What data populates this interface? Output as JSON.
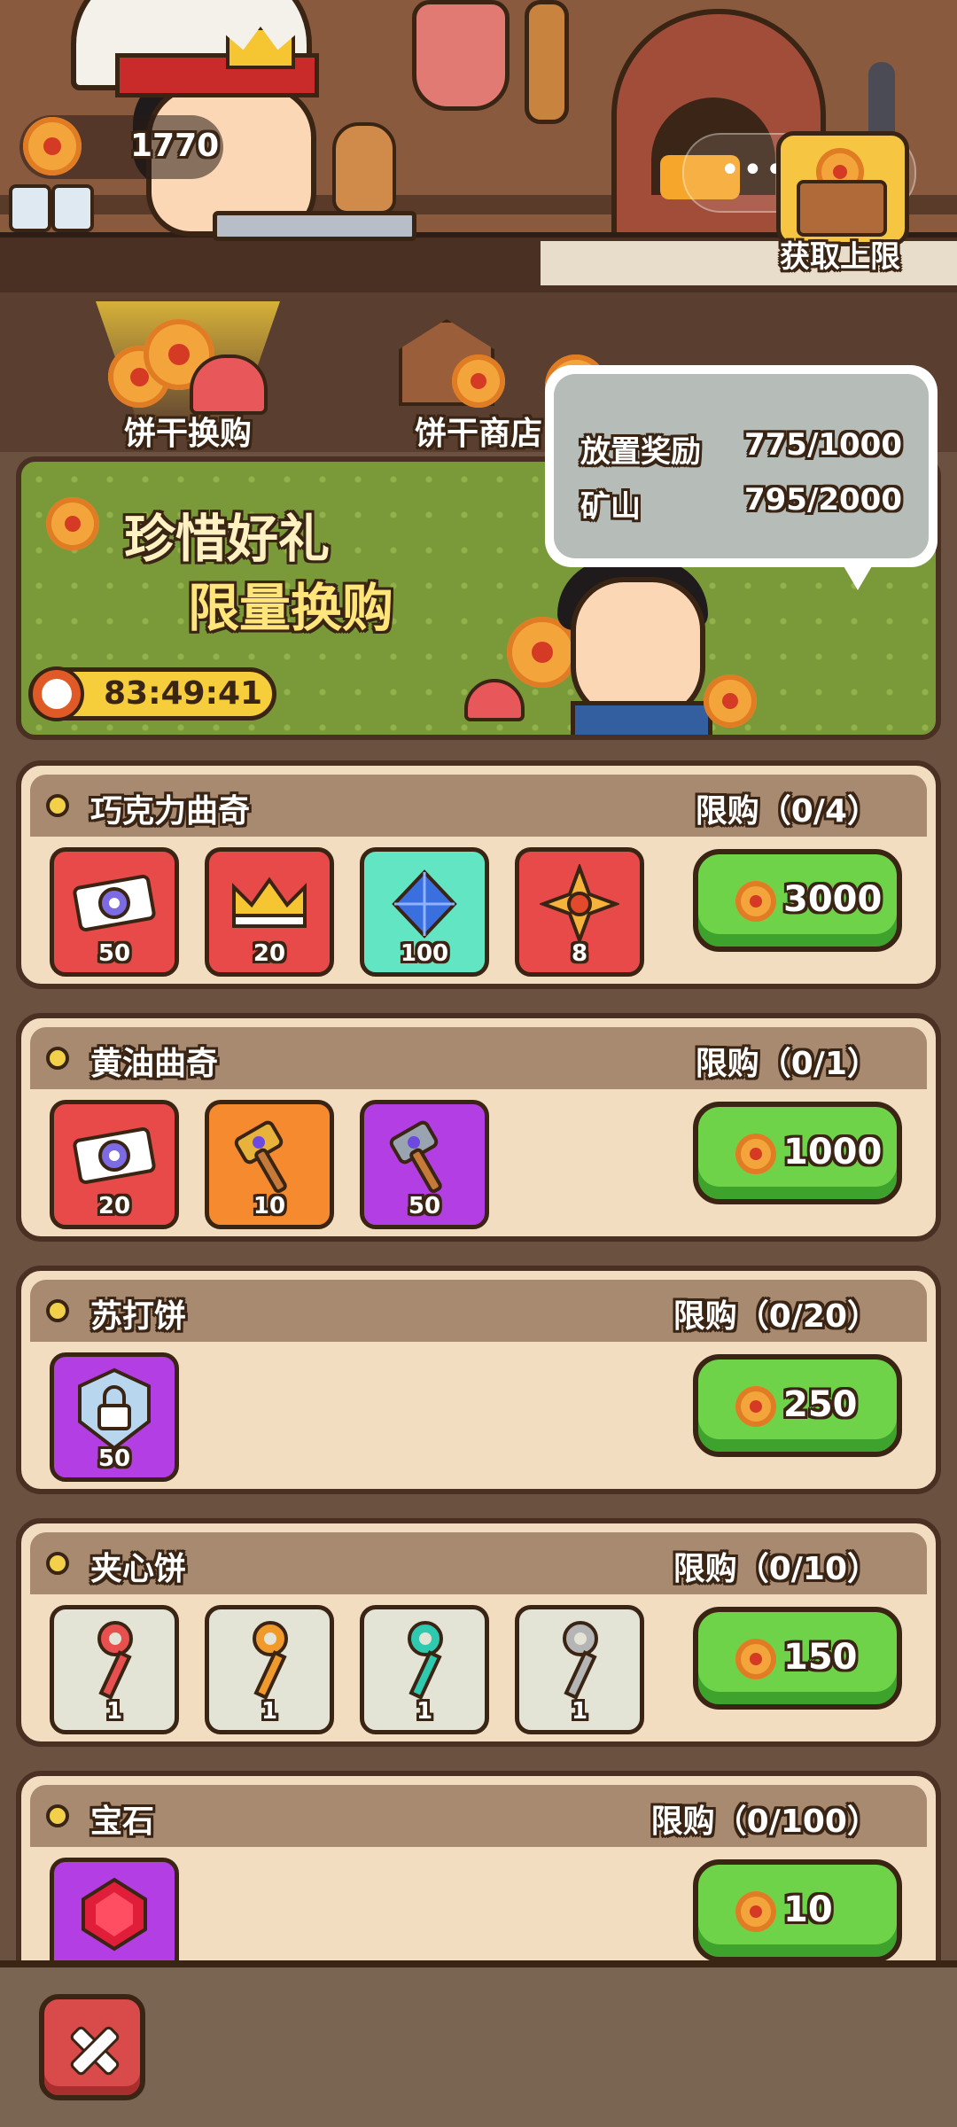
{
  "currency": {
    "icon": "cookie-icon",
    "value": "1770"
  },
  "capsule": {
    "more_icon": "more-icon",
    "more": "•••",
    "target_icon": "target-icon"
  },
  "tabs": [
    {
      "label": "饼干换购",
      "icon": "cookie-exchange-icon",
      "active": true
    },
    {
      "label": "饼干商店",
      "icon": "cookie-shop-icon",
      "active": false
    }
  ],
  "banner": {
    "title_line1": "珍惜好礼",
    "title_line2": "限量换购",
    "timer": "83:49:41",
    "chest_label": "获取上限"
  },
  "tooltip": {
    "rows": [
      {
        "label": "放置奖励",
        "value": "775/1000"
      },
      {
        "label": "矿山",
        "value": "795/2000"
      }
    ]
  },
  "packs": [
    {
      "name": "巧克力曲奇",
      "limit": "限购（0/4）",
      "price": "3000",
      "items": [
        {
          "icon": "ticket-icon",
          "count": "50",
          "bg": "#e84a4a"
        },
        {
          "icon": "crown-icon",
          "count": "20",
          "bg": "#e84a4a"
        },
        {
          "icon": "diamond-icon",
          "count": "100",
          "bg": "#62e5c3"
        },
        {
          "icon": "star-badge-icon",
          "count": "8",
          "bg": "#e84a4a"
        }
      ]
    },
    {
      "name": "黄油曲奇",
      "limit": "限购（0/1）",
      "price": "1000",
      "items": [
        {
          "icon": "ticket-icon",
          "count": "20",
          "bg": "#e84a4a"
        },
        {
          "icon": "hammer-icon",
          "count": "10",
          "bg": "#f68a2e"
        },
        {
          "icon": "hammer-icon",
          "count": "50",
          "bg": "#b33ee3"
        }
      ]
    },
    {
      "name": "苏打饼",
      "limit": "限购（0/20）",
      "price": "250",
      "items": [
        {
          "icon": "lock-shield-icon",
          "count": "50",
          "bg": "#b33ee3"
        }
      ]
    },
    {
      "name": "夹心饼",
      "limit": "限购（0/10）",
      "price": "150",
      "items": [
        {
          "icon": "key-icon",
          "count": "1",
          "bg": "#e3e3d6"
        },
        {
          "icon": "key-icon",
          "count": "1",
          "bg": "#e3e3d6"
        },
        {
          "icon": "key-icon",
          "count": "1",
          "bg": "#e3e3d6"
        },
        {
          "icon": "key-icon",
          "count": "1",
          "bg": "#e3e3d6"
        }
      ]
    },
    {
      "name": "宝石",
      "limit": "限购（0/100）",
      "price": "10",
      "items": [
        {
          "icon": "ruby-icon",
          "count": "",
          "bg": "#b33ee3"
        }
      ]
    }
  ],
  "close_icon": "close-icon",
  "colors": {
    "button_green": "#6ed348",
    "banner_green": "#7a9a3a",
    "panel_beige": "#f3ddc0",
    "header_brown": "#a88a71"
  }
}
